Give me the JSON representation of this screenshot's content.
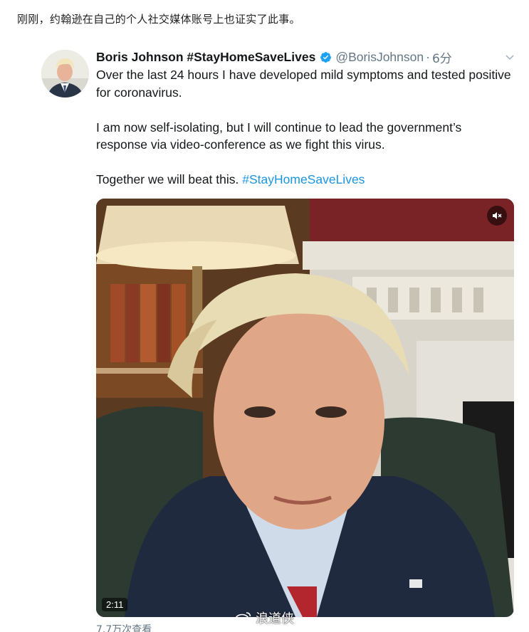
{
  "caption": "刚刚，约翰逊在自己的个人社交媒体账号上也证实了此事。",
  "tweet": {
    "display_name": "Boris Johnson #StayHomeSaveLives",
    "handle": "@BorisJohnson",
    "separator": "·",
    "time": "6分",
    "verified_color": "#1da1f2",
    "paragraphs": [
      "Over the last 24 hours I have developed mild symptoms and tested positive for coronavirus.",
      "I am now self-isolating, but I will continue to lead the government’s response via video-conference as we fight this virus."
    ],
    "final_text": "Together we will beat this. ",
    "final_hashtag": "#StayHomeSaveLives",
    "hashtag_color": "#1b95e0",
    "video": {
      "duration": "2:11",
      "mute_icon": "speaker-muted-icon"
    },
    "views": "7.7万次查看"
  },
  "watermark": {
    "icon": "weibo-logo-icon",
    "text": "浪道侠"
  }
}
